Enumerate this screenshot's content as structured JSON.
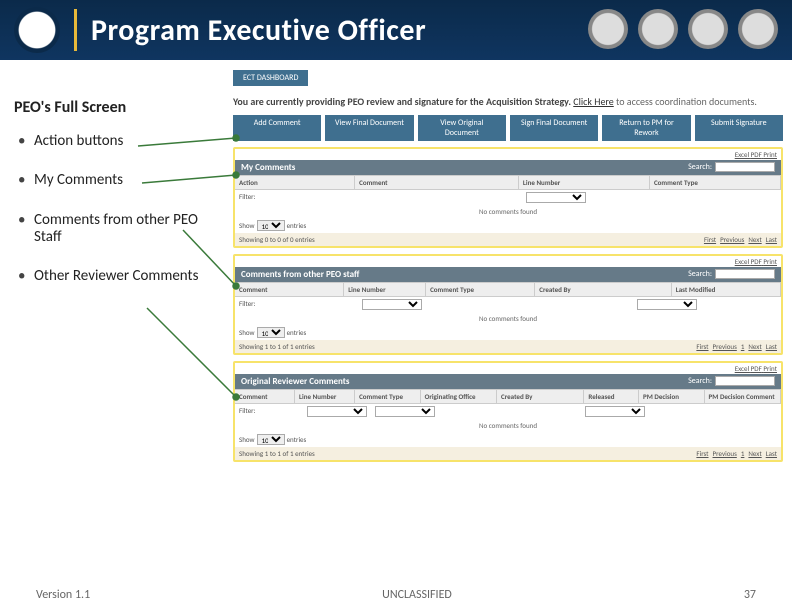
{
  "header": {
    "title": "Program Executive Officer"
  },
  "left": {
    "heading": "PEO's Full Screen",
    "items": [
      "Action buttons",
      "My Comments",
      "Comments from other PEO Staff",
      "Other Reviewer Comments"
    ]
  },
  "app": {
    "tab": "ECT DASHBOARD",
    "note_prefix": "You are currently providing PEO review and signature for the Acquisition Strategy. ",
    "note_link": "Click Here",
    "note_suffix": " to access coordination documents.",
    "buttons": [
      "Add Comment",
      "View Final Document",
      "View Original Document",
      "Sign Final Document",
      "Return to PM for Rework",
      "Submit Signature"
    ],
    "search_label": "Search:",
    "exports": {
      "excel": "Excel",
      "pdf": "PDF",
      "print": "Print"
    },
    "panels": [
      {
        "title": "My Comments",
        "cols": [
          "Action",
          "Comment",
          "Line Number",
          "Comment Type"
        ],
        "filter_label": "Filter:"
      },
      {
        "title": "Comments from other PEO staff",
        "cols": [
          "Comment",
          "Line Number",
          "Comment Type",
          "Created By",
          "Last Modified"
        ],
        "filter_label": "Filter:"
      },
      {
        "title": "Original Reviewer Comments",
        "cols": [
          "Comment",
          "Line Number",
          "Comment Type",
          "Originating Office",
          "Created By",
          "Released",
          "PM Decision",
          "PM Decision Comment"
        ],
        "filter_label": "Filter:"
      }
    ],
    "no_comments": "No comments found",
    "show": "Show",
    "entries_word": "entries",
    "entries_val": "10",
    "showing0": "Showing 0 to 0 of 0 entries",
    "showing1": "Showing 1 to 1 of 1 entries",
    "pager": {
      "first": "First",
      "prev": "Previous",
      "n": "1",
      "next": "Next",
      "last": "Last"
    }
  },
  "footer": {
    "version": "Version 1.1",
    "class": "UNCLASSIFIED",
    "page": "37"
  }
}
